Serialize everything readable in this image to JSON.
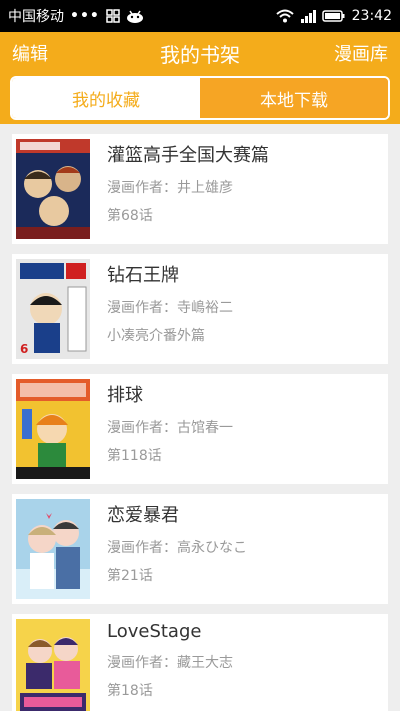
{
  "status_bar": {
    "carrier": "中国移动",
    "dots": "•••",
    "time": "23:42"
  },
  "app_bar": {
    "left_label": "编辑",
    "title": "我的书架",
    "right_label": "漫画库"
  },
  "tabs": [
    {
      "label": "我的收藏",
      "active": true
    },
    {
      "label": "本地下载",
      "active": false
    }
  ],
  "author_prefix": "漫画作者：",
  "comics": [
    {
      "title": "灌篮高手全国大赛篇",
      "author": "井上雄彦",
      "chapter": "第68话",
      "cover_colors": [
        "#1b2a5a",
        "#c0392b",
        "#e8c9a0"
      ]
    },
    {
      "title": "钻石王牌",
      "author": "寺嶋裕二",
      "chapter": "小凑亮介番外篇",
      "cover_colors": [
        "#e7e7e7",
        "#1a3f8a",
        "#d02020"
      ]
    },
    {
      "title": "排球",
      "author": "古馆春一",
      "chapter": "第118话",
      "cover_colors": [
        "#f2c230",
        "#2c8a3c",
        "#e45c2a"
      ]
    },
    {
      "title": "恋爱暴君",
      "author": "高永ひなこ",
      "chapter": "第21话",
      "cover_colors": [
        "#a9d3ea",
        "#f5d6c8",
        "#4a6fa5"
      ]
    },
    {
      "title": "LoveStage",
      "author": "藏王大志",
      "chapter": "第18话",
      "cover_colors": [
        "#f6d34a",
        "#3b2a6b",
        "#e85b9a"
      ]
    }
  ],
  "colors": {
    "accent": "#f4ac1b",
    "background": "#eeeeee",
    "card": "#ffffff",
    "secondary_text": "#9a9a9a"
  }
}
